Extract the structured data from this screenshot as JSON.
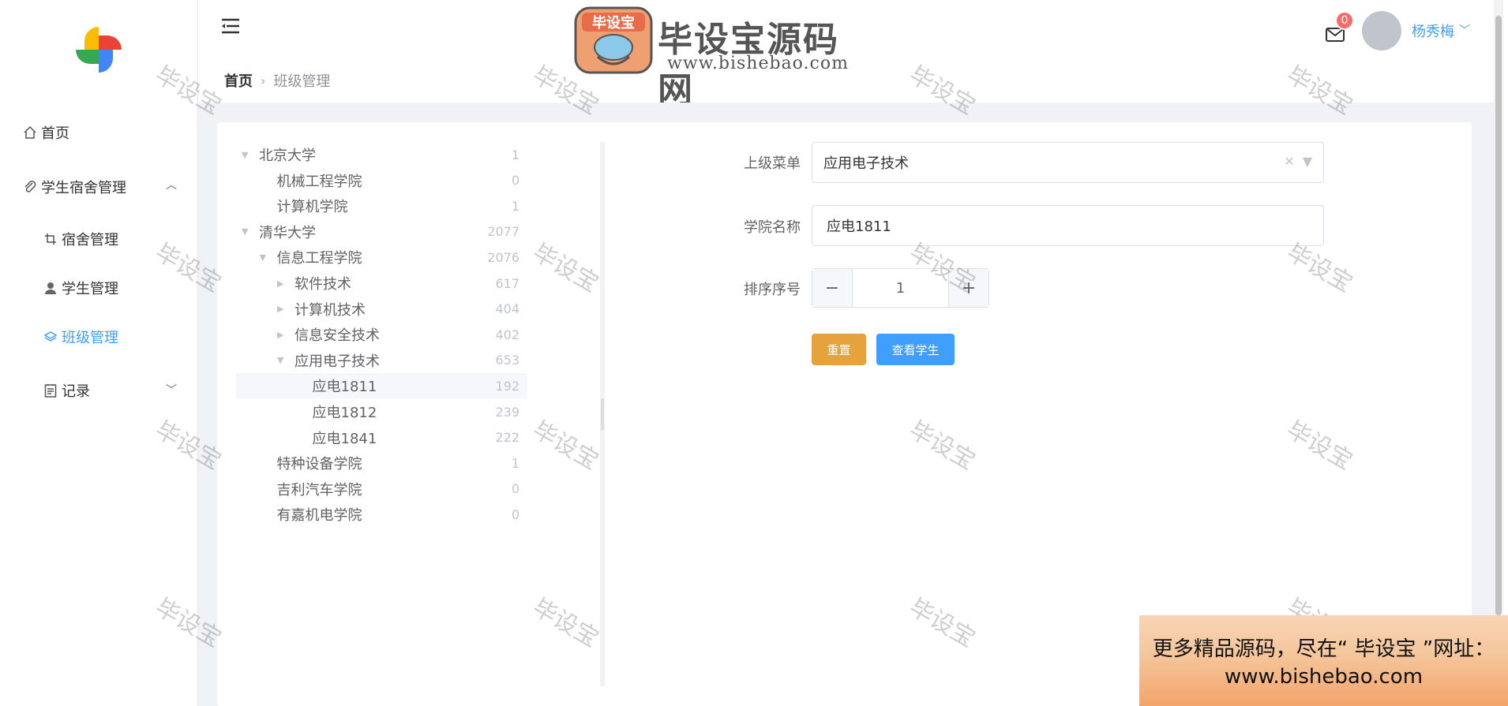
{
  "sidebar": {
    "items": [
      {
        "label": "首页",
        "icon": "home-icon"
      },
      {
        "label": "学生宿舍管理",
        "icon": "paperclip-icon"
      },
      {
        "label": "宿舍管理",
        "icon": "crop-icon"
      },
      {
        "label": "学生管理",
        "icon": "user-icon"
      },
      {
        "label": "班级管理",
        "icon": "layers-icon"
      },
      {
        "label": "记录",
        "icon": "document-icon"
      }
    ],
    "active_color": "#409eff"
  },
  "header": {
    "breadcrumb": {
      "home": "首页",
      "current": "班级管理"
    },
    "brand": {
      "title": "毕设宝源码网",
      "url": "www.bishebao.com",
      "stamp": "毕设宝"
    },
    "mail_badge": "0",
    "username": "杨秀梅"
  },
  "tree": [
    {
      "label": "北京大学",
      "count": "1",
      "caret": "down"
    },
    {
      "label": "机械工程学院",
      "count": "0",
      "caret": ""
    },
    {
      "label": "计算机学院",
      "count": "1",
      "caret": ""
    },
    {
      "label": "清华大学",
      "count": "2077",
      "caret": "down"
    },
    {
      "label": "信息工程学院",
      "count": "2076",
      "caret": "down"
    },
    {
      "label": "软件技术",
      "count": "617",
      "caret": "right"
    },
    {
      "label": "计算机技术",
      "count": "404",
      "caret": "right"
    },
    {
      "label": "信息安全技术",
      "count": "402",
      "caret": "right"
    },
    {
      "label": "应用电子技术",
      "count": "653",
      "caret": "down"
    },
    {
      "label": "应电1811",
      "count": "192",
      "caret": ""
    },
    {
      "label": "应电1812",
      "count": "239",
      "caret": ""
    },
    {
      "label": "应电1841",
      "count": "222",
      "caret": ""
    },
    {
      "label": "特种设备学院",
      "count": "1",
      "caret": ""
    },
    {
      "label": "吉利汽车学院",
      "count": "0",
      "caret": ""
    },
    {
      "label": "有嘉机电学院",
      "count": "0",
      "caret": ""
    }
  ],
  "form": {
    "parent_label": "上级菜单",
    "parent_value": "应用电子技术",
    "name_label": "学院名称",
    "name_value": "应电1811",
    "order_label": "排序序号",
    "order_value": "1",
    "minus": "−",
    "plus": "+",
    "reset_button": "重置",
    "view_students_button": "查看学生"
  },
  "watermark_text": "毕设宝",
  "promo": {
    "line1": "更多精品源码，尽在“ 毕设宝 ”网址：",
    "line2": "www.bishebao.com"
  },
  "colors": {
    "primary": "#409eff",
    "warning": "#e6a23c",
    "badge": "#f56c6c"
  }
}
